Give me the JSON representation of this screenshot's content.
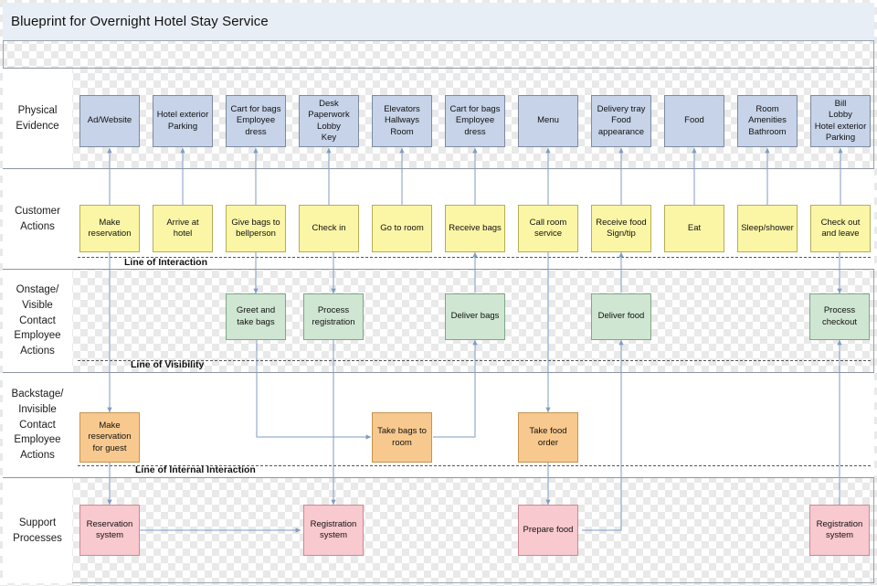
{
  "title": "Blueprint for Overnight Hotel Stay Service",
  "rows": [
    {
      "id": "physical-evidence",
      "label": "Physical\nEvidence"
    },
    {
      "id": "customer-actions",
      "label": "Customer\nActions"
    },
    {
      "id": "onstage-contact-employee-actions",
      "label": "Onstage/\nVisible\nContact\nEmployee\nActions"
    },
    {
      "id": "backstage-contact-employee-actions",
      "label": "Backstage/\nInvisible\nContact\nEmployee\nActions"
    },
    {
      "id": "support-processes",
      "label": "Support\nProcesses"
    }
  ],
  "lines": [
    {
      "id": "line-of-interaction",
      "label": "Line of Interaction"
    },
    {
      "id": "line-of-visibility",
      "label": "Line of Visibility"
    },
    {
      "id": "line-of-internal-interaction",
      "label": "Line of Internal Interaction"
    }
  ],
  "physical_evidence": [
    "Ad/Website",
    "Hotel exterior\nParking",
    "Cart for bags\nEmployee\ndress",
    "Desk\nPaperwork\nLobby\nKey",
    "Elevators\nHallways\nRoom",
    "Cart for bags\nEmployee\ndress",
    "Menu",
    "Delivery tray\nFood\nappearance",
    "Food",
    "Room\nAmenities\nBathroom",
    "Bill\nLobby\nHotel exterior\nParking"
  ],
  "customer_actions": [
    "Make\nreservation",
    "Arrive at hotel",
    "Give bags to\nbellperson",
    "Check in",
    "Go to room",
    "Receive bags",
    "Call room\nservice",
    "Receive food\nSign/tip",
    "Eat",
    "Sleep/shower",
    "Check out\nand leave"
  ],
  "onstage_actions": [
    "Greet and\ntake bags",
    "Process\nregistration",
    "Deliver bags",
    "Deliver food",
    "Process\ncheckout"
  ],
  "backstage_actions": [
    "Make\nreservation\nfor guest",
    "Take bags to\nroom",
    "Take food\norder"
  ],
  "support_processes": [
    "Reservation\nsystem",
    "Registration\nsystem",
    "Prepare food",
    "Registration\nsystem"
  ],
  "colors": {
    "title_bar": "#e8eef6",
    "physical_evidence": "#c6d3e8",
    "customer_actions": "#fbf6a6",
    "onstage": "#cfe6d2",
    "backstage": "#f8c98e",
    "support": "#f8c9ce",
    "arrow": "#7f9bc4",
    "border": "#6f6f6f"
  }
}
